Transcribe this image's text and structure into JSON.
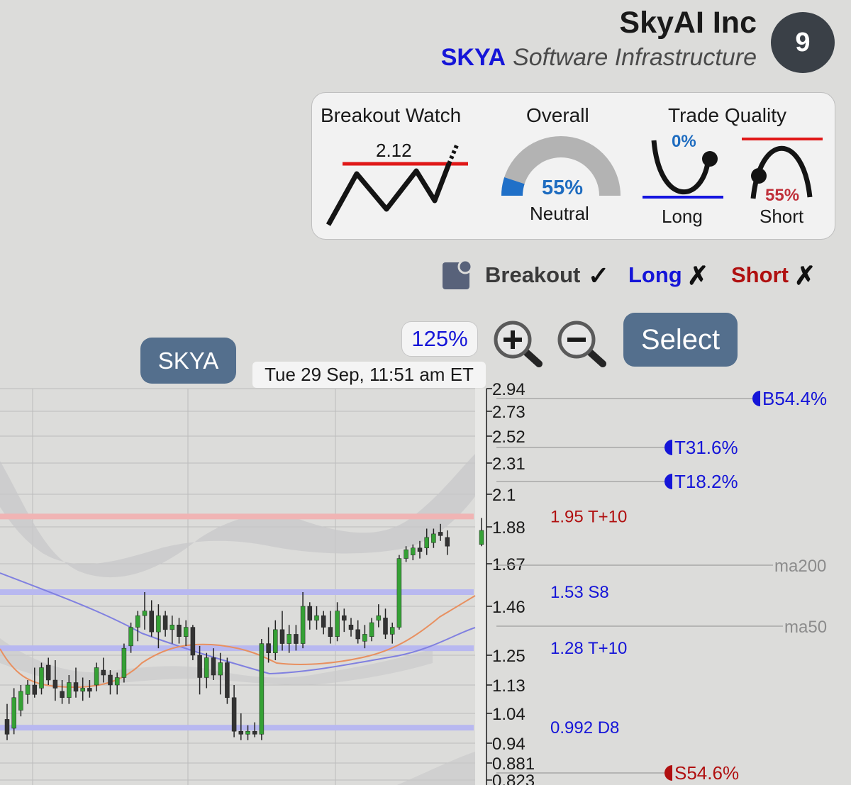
{
  "header": {
    "company": "SkyAI Inc",
    "ticker": "SKYA",
    "sector": "Software Infrastructure",
    "score": "9"
  },
  "panel": {
    "breakout_watch": {
      "title": "Breakout Watch",
      "value": "2.12"
    },
    "overall": {
      "title": "Overall",
      "percent": "55%",
      "label": "Neutral",
      "fill_fraction": 0.1
    },
    "trade_quality": {
      "title": "Trade Quality",
      "long": {
        "percent": "0%",
        "label": "Long"
      },
      "short": {
        "percent": "55%",
        "label": "Short"
      }
    }
  },
  "flags": {
    "breakout": {
      "label": "Breakout",
      "mark": "✓"
    },
    "long": {
      "label": "Long",
      "mark": "✗"
    },
    "short": {
      "label": "Short",
      "mark": "✗"
    }
  },
  "controls": {
    "zoom_level": "125%",
    "select_label": "Select",
    "symbol_label": "SKYA",
    "timestamp": "Tue 29 Sep, 11:51 am ET"
  },
  "colors": {
    "ticker_blue": "#1515d8",
    "red": "#cc1010",
    "candle_up": "#35a135",
    "candle_down": "#333333",
    "ma50": "#8080e0",
    "ma200": "#e89060",
    "band": "#c8c8ca"
  },
  "icons": [
    "note-icon",
    "zoom-in-icon",
    "zoom-out-icon",
    "check-icon",
    "cross-icon"
  ],
  "chart_data": {
    "type": "candlestick",
    "y_axis_ticks": [
      "2.94",
      "2.73",
      "2.52",
      "2.31",
      "2.1",
      "1.88",
      "1.67",
      "1.46",
      "1.25",
      "1.13",
      "1.04",
      "0.94",
      "0.881",
      "0.823"
    ],
    "levels": [
      {
        "value": 1.95,
        "label": "1.95",
        "tag": "T+10",
        "color": "#b01010"
      },
      {
        "value": 1.53,
        "label": "1.53",
        "tag": "S8",
        "color": "#1515d8"
      },
      {
        "value": 1.28,
        "label": "1.28",
        "tag": "T+10",
        "color": "#1515d8"
      },
      {
        "value": 0.992,
        "label": "0.992",
        "tag": "D8",
        "color": "#1515d8"
      }
    ],
    "targets": [
      {
        "value": 2.94,
        "label": "B 54.4%",
        "color": "#1515d8"
      },
      {
        "value": 2.52,
        "label": "T 31.6%",
        "color": "#1515d8"
      },
      {
        "value": 2.2,
        "label": "T 18.2%",
        "color": "#1515d8"
      },
      {
        "value": 0.84,
        "label": "S 54.6%",
        "color": "#b01010"
      }
    ],
    "ma_lines": [
      {
        "name": "ma200",
        "value": 1.66
      },
      {
        "name": "ma50",
        "value": 1.4
      }
    ],
    "candles": [
      {
        "o": 1.02,
        "h": 1.07,
        "l": 0.95,
        "c": 0.97
      },
      {
        "o": 0.99,
        "h": 1.12,
        "l": 0.97,
        "c": 1.09
      },
      {
        "o": 1.05,
        "h": 1.13,
        "l": 1.03,
        "c": 1.11
      },
      {
        "o": 1.1,
        "h": 1.15,
        "l": 1.07,
        "c": 1.13
      },
      {
        "o": 1.13,
        "h": 1.2,
        "l": 1.09,
        "c": 1.1
      },
      {
        "o": 1.12,
        "h": 1.22,
        "l": 1.1,
        "c": 1.2
      },
      {
        "o": 1.21,
        "h": 1.24,
        "l": 1.13,
        "c": 1.15
      },
      {
        "o": 1.15,
        "h": 1.23,
        "l": 1.08,
        "c": 1.12
      },
      {
        "o": 1.11,
        "h": 1.15,
        "l": 1.07,
        "c": 1.09
      },
      {
        "o": 1.09,
        "h": 1.17,
        "l": 1.07,
        "c": 1.14
      },
      {
        "o": 1.14,
        "h": 1.2,
        "l": 1.09,
        "c": 1.11
      },
      {
        "o": 1.11,
        "h": 1.16,
        "l": 1.08,
        "c": 1.12
      },
      {
        "o": 1.12,
        "h": 1.15,
        "l": 1.09,
        "c": 1.11
      },
      {
        "o": 1.13,
        "h": 1.22,
        "l": 1.11,
        "c": 1.2
      },
      {
        "o": 1.19,
        "h": 1.24,
        "l": 1.14,
        "c": 1.17
      },
      {
        "o": 1.17,
        "h": 1.19,
        "l": 1.1,
        "c": 1.13
      },
      {
        "o": 1.13,
        "h": 1.18,
        "l": 1.1,
        "c": 1.16
      },
      {
        "o": 1.16,
        "h": 1.3,
        "l": 1.14,
        "c": 1.28
      },
      {
        "o": 1.29,
        "h": 1.39,
        "l": 1.26,
        "c": 1.37
      },
      {
        "o": 1.37,
        "h": 1.44,
        "l": 1.31,
        "c": 1.42
      },
      {
        "o": 1.42,
        "h": 1.53,
        "l": 1.36,
        "c": 1.44
      },
      {
        "o": 1.44,
        "h": 1.49,
        "l": 1.33,
        "c": 1.35
      },
      {
        "o": 1.35,
        "h": 1.47,
        "l": 1.28,
        "c": 1.42
      },
      {
        "o": 1.42,
        "h": 1.44,
        "l": 1.33,
        "c": 1.36
      },
      {
        "o": 1.36,
        "h": 1.42,
        "l": 1.3,
        "c": 1.38
      },
      {
        "o": 1.38,
        "h": 1.41,
        "l": 1.3,
        "c": 1.33
      },
      {
        "o": 1.33,
        "h": 1.4,
        "l": 1.29,
        "c": 1.37
      },
      {
        "o": 1.37,
        "h": 1.38,
        "l": 1.23,
        "c": 1.25
      },
      {
        "o": 1.25,
        "h": 1.29,
        "l": 1.1,
        "c": 1.16
      },
      {
        "o": 1.16,
        "h": 1.26,
        "l": 1.12,
        "c": 1.24
      },
      {
        "o": 1.24,
        "h": 1.28,
        "l": 1.15,
        "c": 1.17
      },
      {
        "o": 1.17,
        "h": 1.26,
        "l": 1.1,
        "c": 1.22
      },
      {
        "o": 1.22,
        "h": 1.24,
        "l": 1.07,
        "c": 1.09
      },
      {
        "o": 1.09,
        "h": 1.13,
        "l": 0.96,
        "c": 0.98
      },
      {
        "o": 0.98,
        "h": 1.04,
        "l": 0.95,
        "c": 0.97
      },
      {
        "o": 0.97,
        "h": 1.0,
        "l": 0.95,
        "c": 0.98
      },
      {
        "o": 0.98,
        "h": 1.01,
        "l": 0.96,
        "c": 0.97
      },
      {
        "o": 0.97,
        "h": 1.32,
        "l": 0.95,
        "c": 1.3
      },
      {
        "o": 1.3,
        "h": 1.37,
        "l": 1.22,
        "c": 1.26
      },
      {
        "o": 1.26,
        "h": 1.4,
        "l": 1.23,
        "c": 1.36
      },
      {
        "o": 1.36,
        "h": 1.44,
        "l": 1.27,
        "c": 1.3
      },
      {
        "o": 1.3,
        "h": 1.38,
        "l": 1.26,
        "c": 1.34
      },
      {
        "o": 1.34,
        "h": 1.38,
        "l": 1.27,
        "c": 1.3
      },
      {
        "o": 1.3,
        "h": 1.53,
        "l": 1.28,
        "c": 1.46
      },
      {
        "o": 1.46,
        "h": 1.48,
        "l": 1.36,
        "c": 1.4
      },
      {
        "o": 1.4,
        "h": 1.46,
        "l": 1.36,
        "c": 1.42
      },
      {
        "o": 1.42,
        "h": 1.44,
        "l": 1.34,
        "c": 1.37
      },
      {
        "o": 1.37,
        "h": 1.44,
        "l": 1.3,
        "c": 1.33
      },
      {
        "o": 1.33,
        "h": 1.48,
        "l": 1.31,
        "c": 1.44
      },
      {
        "o": 1.42,
        "h": 1.45,
        "l": 1.35,
        "c": 1.4
      },
      {
        "o": 1.38,
        "h": 1.41,
        "l": 1.33,
        "c": 1.36
      },
      {
        "o": 1.36,
        "h": 1.4,
        "l": 1.3,
        "c": 1.32
      },
      {
        "o": 1.31,
        "h": 1.38,
        "l": 1.28,
        "c": 1.34
      },
      {
        "o": 1.33,
        "h": 1.41,
        "l": 1.31,
        "c": 1.39
      },
      {
        "o": 1.4,
        "h": 1.47,
        "l": 1.37,
        "c": 1.42
      },
      {
        "o": 1.41,
        "h": 1.45,
        "l": 1.32,
        "c": 1.34
      },
      {
        "o": 1.34,
        "h": 1.39,
        "l": 1.3,
        "c": 1.37
      },
      {
        "o": 1.37,
        "h": 1.72,
        "l": 1.36,
        "c": 1.7
      },
      {
        "o": 1.7,
        "h": 1.77,
        "l": 1.68,
        "c": 1.75
      },
      {
        "o": 1.72,
        "h": 1.78,
        "l": 1.69,
        "c": 1.76
      },
      {
        "o": 1.76,
        "h": 1.8,
        "l": 1.7,
        "c": 1.74
      },
      {
        "o": 1.76,
        "h": 1.87,
        "l": 1.72,
        "c": 1.82
      },
      {
        "o": 1.79,
        "h": 1.87,
        "l": 1.76,
        "c": 1.84
      },
      {
        "o": 1.85,
        "h": 1.9,
        "l": 1.8,
        "c": 1.83
      },
      {
        "o": 1.82,
        "h": 1.86,
        "l": 1.72,
        "c": 1.77
      },
      {
        "o": 1.78,
        "h": 1.94,
        "l": 1.77,
        "c": 1.86
      }
    ]
  }
}
